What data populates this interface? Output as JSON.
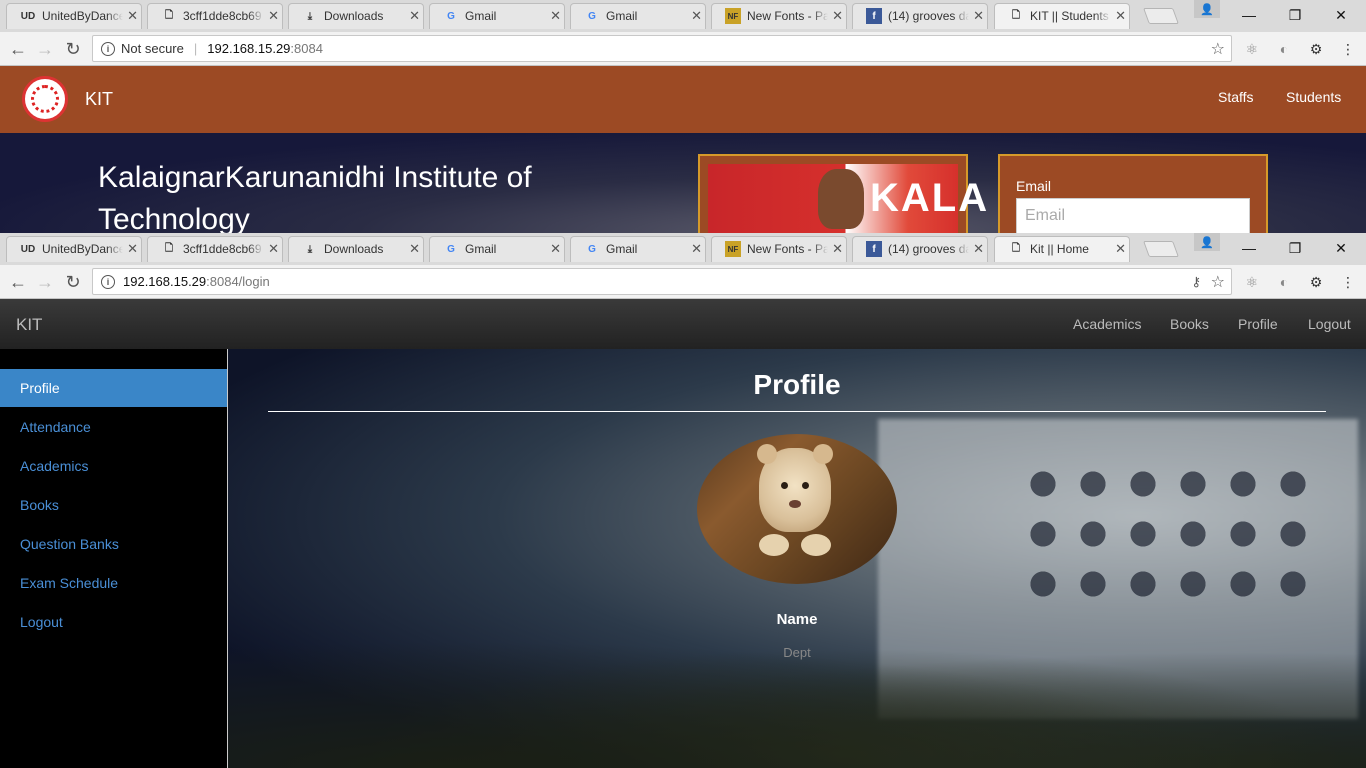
{
  "top_window": {
    "tabs": [
      {
        "icon": "ubd-favicon-icon",
        "favicon_text": "UD",
        "title": "UnitedByDance"
      },
      {
        "icon": "document-icon",
        "title": "3cff1dde8cb69"
      },
      {
        "icon": "download-icon",
        "title": "Downloads"
      },
      {
        "icon": "google-icon",
        "favicon_text": "G",
        "title": "Gmail"
      },
      {
        "icon": "google-icon",
        "favicon_text": "G",
        "title": "Gmail"
      },
      {
        "icon": "fonts-favicon-icon",
        "favicon_text": "NF",
        "title": "New Fonts - Pa"
      },
      {
        "icon": "facebook-icon",
        "favicon_text": "f",
        "title": "(14) grooves da"
      },
      {
        "icon": "document-icon",
        "title": "KIT || Students",
        "active": true
      }
    ],
    "address": {
      "security": "Not secure",
      "host": "192.168.15.29",
      "rest": ":8084"
    },
    "site": {
      "brand": "KIT",
      "nav": [
        "Staffs",
        "Students"
      ],
      "hero_title": "KalaignarKarunanidhi Institute of Technology",
      "photo_banner_text": "KALA",
      "login": {
        "email_label": "Email",
        "email_placeholder": "Email"
      }
    }
  },
  "bottom_window": {
    "tabs": [
      {
        "icon": "ubd-favicon-icon",
        "favicon_text": "UD",
        "title": "UnitedByDance"
      },
      {
        "icon": "document-icon",
        "title": "3cff1dde8cb69"
      },
      {
        "icon": "download-icon",
        "title": "Downloads"
      },
      {
        "icon": "google-icon",
        "favicon_text": "G",
        "title": "Gmail"
      },
      {
        "icon": "google-icon",
        "favicon_text": "G",
        "title": "Gmail"
      },
      {
        "icon": "fonts-favicon-icon",
        "favicon_text": "NF",
        "title": "New Fonts - Pa"
      },
      {
        "icon": "facebook-icon",
        "favicon_text": "f",
        "title": "(14) grooves da"
      },
      {
        "icon": "document-icon",
        "title": "Kit || Home",
        "active": true
      }
    ],
    "address": {
      "host": "192.168.15.29",
      "rest": ":8084/login"
    },
    "site": {
      "brand": "KIT",
      "nav": [
        "Academics",
        "Books",
        "Profile",
        "Logout"
      ],
      "sidebar": [
        "Profile",
        "Attendance",
        "Academics",
        "Books",
        "Question Banks",
        "Exam Schedule",
        "Logout"
      ],
      "active_sidebar": "Profile",
      "page_title": "Profile",
      "name_label": "Name",
      "dept_label": "Dept"
    }
  },
  "colors": {
    "orange_nav": "#9c4a24",
    "frame_gold": "#d69a2a",
    "sidebar_active": "#3a86c8",
    "sidebar_link": "#4a8fd6"
  }
}
